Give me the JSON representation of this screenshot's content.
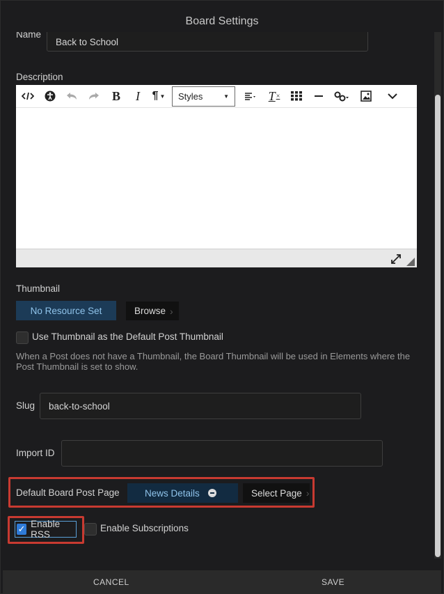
{
  "dialog": {
    "title": "Board Settings"
  },
  "name_field": {
    "label": "Name",
    "value": "Back to School"
  },
  "description": {
    "label": "Description",
    "toolbar": {
      "source_icon": "code-icon",
      "accessibility_icon": "accessibility-icon",
      "undo_icon": "undo-icon",
      "redo_icon": "redo-icon",
      "bold": "B",
      "italic": "I",
      "paragraph": "¶",
      "styles_label": "Styles",
      "align_icon": "align-left-icon",
      "clear_format": "T",
      "table_icon": "table-icon",
      "hr_icon": "horizontal-rule-icon",
      "link_icon": "link-icon",
      "image_icon": "image-icon",
      "more_icon": "chevron-down-icon"
    }
  },
  "thumbnail": {
    "label": "Thumbnail",
    "resource_button": "No Resource Set",
    "browse_button": "Browse",
    "default_checkbox_label": "Use Thumbnail as the Default Post Thumbnail",
    "help_text": "When a Post does not have a Thumbnail, the Board Thumbnail will be used in Elements where the Post Thumbnail is set to show."
  },
  "slug": {
    "label": "Slug",
    "value": "back-to-school"
  },
  "import_id": {
    "label": "Import ID",
    "value": ""
  },
  "default_post_page": {
    "label": "Default Board Post Page",
    "selected": "News Details",
    "select_button": "Select Page"
  },
  "rss": {
    "label": "Enable RSS",
    "checked": true
  },
  "subscriptions": {
    "label": "Enable Subscriptions",
    "checked": false
  },
  "footer": {
    "cancel": "CANCEL",
    "save": "SAVE"
  },
  "colors": {
    "highlight": "#c83a31",
    "accent": "#1c3b57",
    "accent_text": "#8fc3ea",
    "check": "#2f7bd8"
  }
}
